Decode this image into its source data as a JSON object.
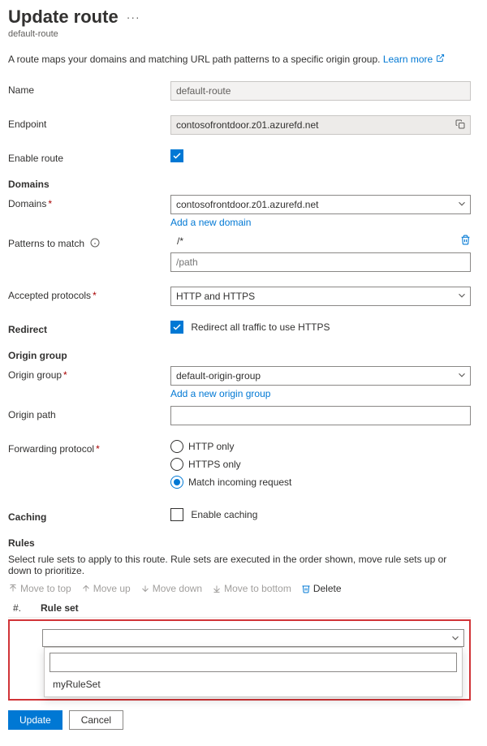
{
  "title": "Update route",
  "subtitle": "default-route",
  "helptext": "A route maps your domains and matching URL path patterns to a specific origin group.",
  "learn_more": "Learn more",
  "labels": {
    "name": "Name",
    "endpoint": "Endpoint",
    "enable_route": "Enable route",
    "domains_section": "Domains",
    "domains": "Domains",
    "add_domain": "Add a new domain",
    "patterns": "Patterns to match",
    "path_placeholder": "/path",
    "accepted_protocols": "Accepted protocols",
    "redirect_section": "Redirect",
    "redirect_cb": "Redirect all traffic to use HTTPS",
    "origin_group_section": "Origin group",
    "origin_group": "Origin group",
    "add_origin_group": "Add a new origin group",
    "origin_path": "Origin path",
    "forwarding_protocol": "Forwarding protocol",
    "caching_section": "Caching",
    "enable_caching": "Enable caching",
    "rules_section": "Rules",
    "rules_desc": "Select rule sets to apply to this route. Rule sets are executed in the order shown, move rule sets up or down to prioritize.",
    "col_num": "#.",
    "col_ruleset": "Rule set"
  },
  "toolbar": {
    "move_top": "Move to top",
    "move_up": "Move up",
    "move_down": "Move down",
    "move_bottom": "Move to bottom",
    "delete": "Delete"
  },
  "values": {
    "name": "default-route",
    "endpoint": "contosofrontdoor.z01.azurefd.net",
    "domain": "contosofrontdoor.z01.azurefd.net",
    "pattern1": "/*",
    "accepted_protocols": "HTTP and HTTPS",
    "origin_group": "default-origin-group"
  },
  "forwarding_options": {
    "http": "HTTP only",
    "https": "HTTPS only",
    "match": "Match incoming request"
  },
  "ruleset_option": "myRuleSet",
  "buttons": {
    "update": "Update",
    "cancel": "Cancel"
  }
}
